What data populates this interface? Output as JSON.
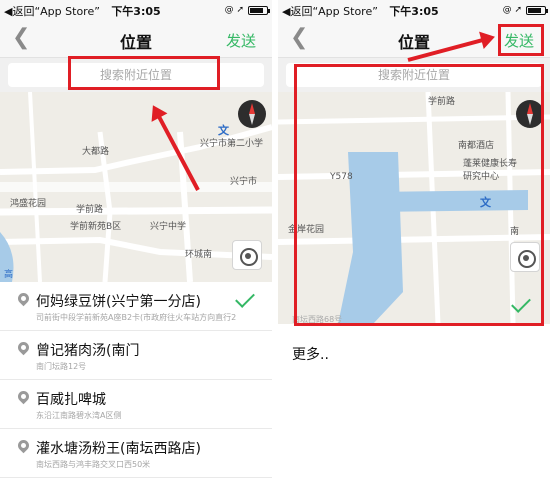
{
  "status_bar": {
    "back_text": "◀返回“App Store”",
    "time": "下午3:05",
    "signal_glyph": "@ ➚"
  },
  "left": {
    "nav": {
      "back_icon": "chevron-left-icon",
      "title": "位置",
      "send_label": "发送"
    },
    "search": {
      "placeholder": "搜索附近位置"
    },
    "map_labels": {
      "road_dashed": "大都路",
      "school": "兴宁市第二小学",
      "garden": "鸿盛花园",
      "xuenan": "学前路",
      "xinyuan": "学前新苑B区",
      "middle": "兴宁中学",
      "ring_road": "环城南",
      "city": "兴宁市",
      "wen": "文",
      "gao": "高"
    },
    "places": [
      {
        "title": "何妈绿豆饼(兴宁第一分店)",
        "subtitle": "司前街中段学前新苑A座B2卡(市政府往火车站方向直行2…",
        "selected": true
      },
      {
        "title": "曾记猪肉汤(南门",
        "subtitle": "南门坛路12号",
        "selected": false
      },
      {
        "title": "百威扎啤城",
        "subtitle": "东沿江南路碧水湾A区侧",
        "selected": false
      },
      {
        "title": "灌水塘汤粉王(南坛西路店)",
        "subtitle": "南坛西路与鸿丰路交叉口西50米",
        "selected": false
      }
    ]
  },
  "right": {
    "nav": {
      "title": "位置",
      "send_label": "发送"
    },
    "search": {
      "placeholder": "搜索附近位置"
    },
    "map_labels": {
      "top_road": "学前路",
      "hotel": "南都酒店",
      "health": "蓬莱健康长寿研究中心",
      "y578": "Y578",
      "anyuan": "金岸花园",
      "nan": "南",
      "wen": "文"
    },
    "selected_place": {
      "subtitle": "南坛西路68号",
      "selected": true
    },
    "more_label": "更多.."
  },
  "colors": {
    "accent_green": "#35b865",
    "annotation_red": "#e01e25"
  }
}
